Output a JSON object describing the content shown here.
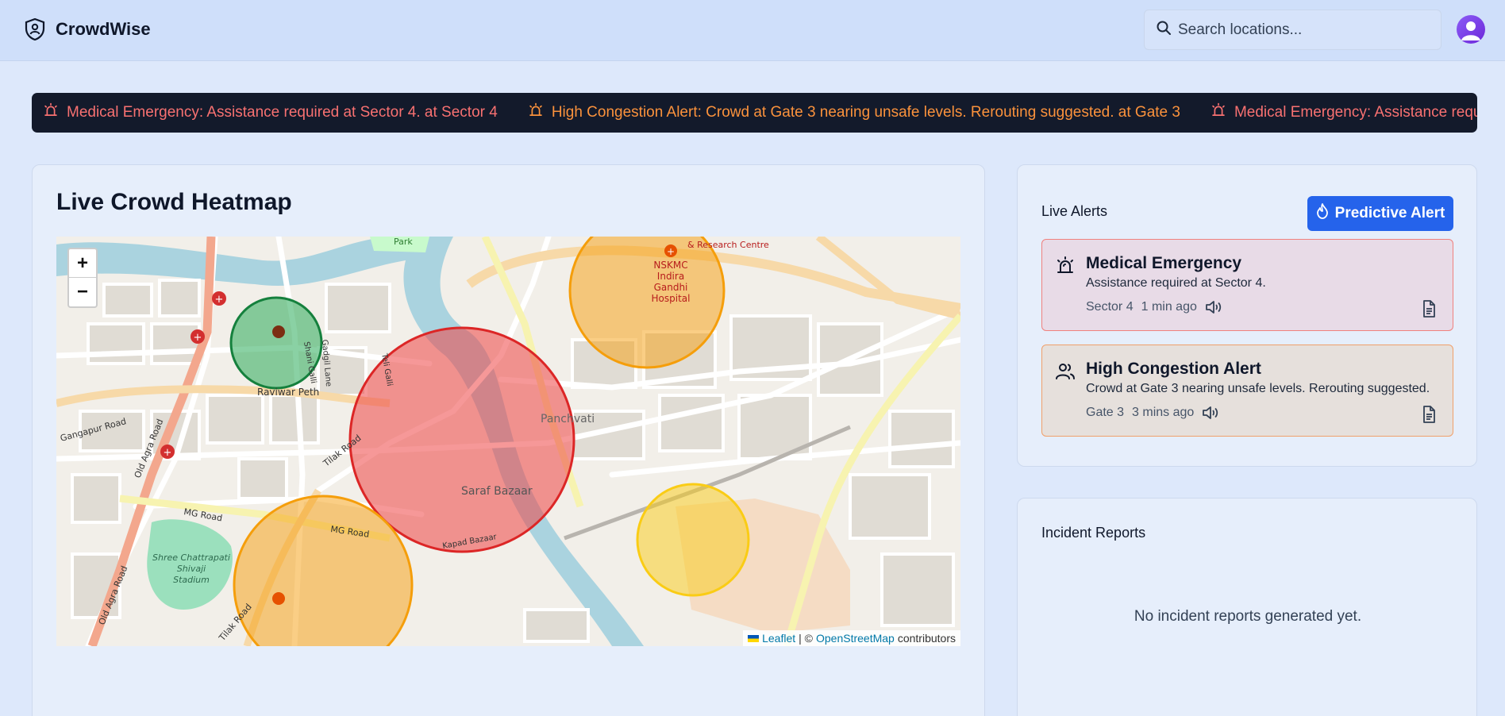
{
  "app": {
    "name": "CrowdWise"
  },
  "search": {
    "placeholder": "Search locations..."
  },
  "ticker": [
    {
      "text": "Medical Emergency: Assistance required at Sector 4. at Sector 4",
      "level": "red"
    },
    {
      "text": "High Congestion Alert: Crowd at Gate 3 nearing unsafe levels. Rerouting suggested. at Gate 3",
      "level": "orange"
    },
    {
      "text": "Medical Emergency: Assistance required at Sector 4. at Sector 4",
      "level": "red"
    }
  ],
  "heatmap": {
    "title": "Live Crowd Heatmap",
    "zoom_in": "+",
    "zoom_out": "−",
    "attribution": {
      "leaflet": "Leaflet",
      "sep": "| ©",
      "osm": "OpenStreetMap",
      "suffix": "contributors"
    },
    "labels": {
      "raviwar_peth": "Raviwar Peth",
      "saraf_bazaar": "Saraf Bazaar",
      "panchvati": "Panchvati",
      "mg_road": "MG Road",
      "mg_road_2": "MG Road",
      "gangapur_road": "Gangapur Road",
      "old_agra_road": "Old Agra Road",
      "old_agra_road_2": "Old Agra Road",
      "tilak_road": "Tilak Road",
      "tilak_road_2": "Tilak Road",
      "kapad_bazaar": "Kapad Bazaar",
      "gadgil_lane": "Gadgil Lane",
      "shani_galli": "Shani Galli",
      "teli_galli": "Teli Galli",
      "park": "Park",
      "research_centre": "& Research Centre",
      "hospital": [
        "NSKMC",
        "Indira",
        "Gandhi",
        "Hospital"
      ],
      "stadium": [
        "Shree Chattrapati",
        "Shivaji",
        "Stadium"
      ]
    },
    "zone_colors": {
      "high": "#ef4444",
      "medium": "#f59e0b",
      "low_medium": "#facc15",
      "low": "#16a34a"
    }
  },
  "alerts": {
    "title": "Live Alerts",
    "predict_button": "Predictive Alert",
    "items": [
      {
        "title": "Medical Emergency",
        "desc": "Assistance required at Sector 4.",
        "location": "Sector 4",
        "time": "1 min ago",
        "level": "red",
        "icon": "siren-icon"
      },
      {
        "title": "High Congestion Alert",
        "desc": "Crowd at Gate 3 nearing unsafe levels. Rerouting suggested.",
        "location": "Gate 3",
        "time": "3 mins ago",
        "level": "orange",
        "icon": "users-icon"
      }
    ]
  },
  "incidents": {
    "title": "Incident Reports",
    "empty": "No incident reports generated yet."
  }
}
